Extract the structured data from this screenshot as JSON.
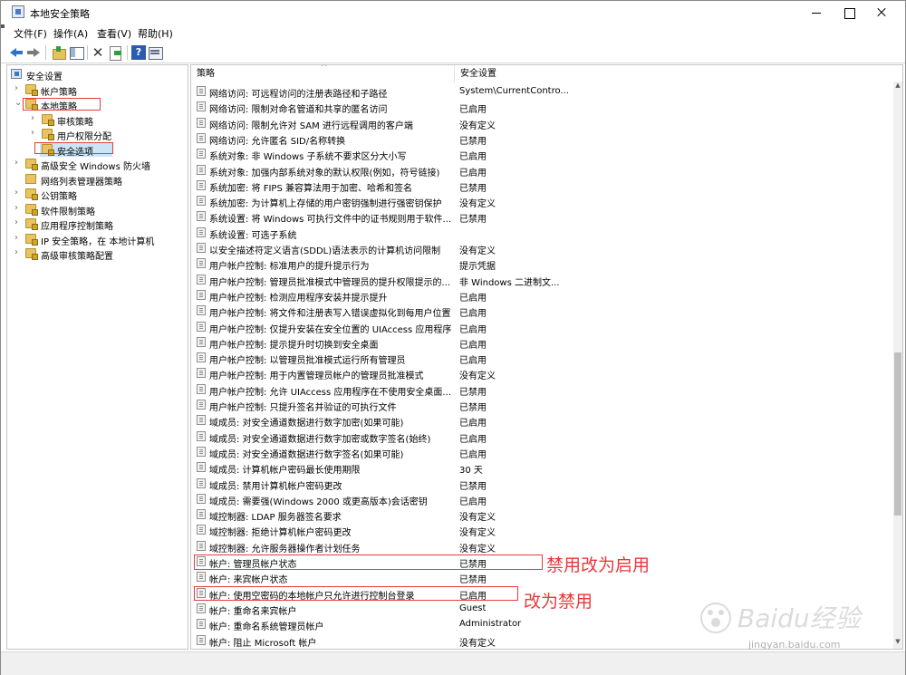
{
  "window": {
    "title": "本地安全策略",
    "minimize_icon": "minimize-icon",
    "maximize_icon": "maximize-icon",
    "close_icon": "close-icon"
  },
  "menubar": {
    "items": [
      "文件(F)",
      "操作(A)",
      "查看(V)",
      "帮助(H)"
    ]
  },
  "toolbar": {
    "icons": [
      "back-arrow-icon",
      "forward-arrow-icon",
      "up-folder-icon",
      "show-hide-tree-icon",
      "delete-icon",
      "export-list-icon",
      "help-icon",
      "properties-icon"
    ],
    "delete_glyph": "✕",
    "help_glyph": "?"
  },
  "tree": {
    "items": [
      {
        "label": "安全设置",
        "level": 0,
        "expanded": true
      },
      {
        "label": "帐户策略",
        "level": 1,
        "expanded": false
      },
      {
        "label": "本地策略",
        "level": 1,
        "expanded": true
      },
      {
        "label": "审核策略",
        "level": 2,
        "expanded": false
      },
      {
        "label": "用户权限分配",
        "level": 2,
        "expanded": false
      },
      {
        "label": "安全选项",
        "level": 2,
        "selected": true
      },
      {
        "label": "高级安全 Windows 防火墙",
        "level": 1,
        "expanded": false
      },
      {
        "label": "网络列表管理器策略",
        "level": 1
      },
      {
        "label": "公钥策略",
        "level": 1,
        "expanded": false
      },
      {
        "label": "软件限制策略",
        "level": 1,
        "expanded": false
      },
      {
        "label": "应用程序控制策略",
        "level": 1,
        "expanded": false
      },
      {
        "label": "IP 安全策略，在 本地计算机",
        "level": 1,
        "expanded": false
      },
      {
        "label": "高级审核策略配置",
        "level": 1,
        "expanded": false
      }
    ]
  },
  "list": {
    "columns": {
      "policy": "策略",
      "setting": "安全设置"
    },
    "rows": [
      {
        "policy": "网络访问: 可远程访问的注册表路径和子路径",
        "setting": "System\\CurrentContro..."
      },
      {
        "policy": "网络访问: 限制对命名管道和共享的匿名访问",
        "setting": "已启用"
      },
      {
        "policy": "网络访问: 限制允许对 SAM 进行远程调用的客户端",
        "setting": "没有定义"
      },
      {
        "policy": "网络访问: 允许匿名 SID/名称转换",
        "setting": "已禁用"
      },
      {
        "policy": "系统对象: 非 Windows 子系统不要求区分大小写",
        "setting": "已启用"
      },
      {
        "policy": "系统对象: 加强内部系统对象的默认权限(例如，符号链接)",
        "setting": "已启用"
      },
      {
        "policy": "系统加密: 将 FIPS 兼容算法用于加密、哈希和签名",
        "setting": "已禁用"
      },
      {
        "policy": "系统加密: 为计算机上存储的用户密钥强制进行强密钥保护",
        "setting": "没有定义"
      },
      {
        "policy": "系统设置: 将 Windows 可执行文件中的证书规则用于软件...",
        "setting": "已禁用"
      },
      {
        "policy": "系统设置: 可选子系统",
        "setting": ""
      },
      {
        "policy": "以安全描述符定义语言(SDDL)语法表示的计算机访问限制",
        "setting": "没有定义"
      },
      {
        "policy": "用户帐户控制: 标准用户的提升提示行为",
        "setting": "提示凭据"
      },
      {
        "policy": "用户帐户控制: 管理员批准模式中管理员的提升权限提示的...",
        "setting": "非 Windows 二进制文..."
      },
      {
        "policy": "用户帐户控制: 检测应用程序安装并提示提升",
        "setting": "已启用"
      },
      {
        "policy": "用户帐户控制: 将文件和注册表写入错误虚拟化到每用户位置",
        "setting": "已启用"
      },
      {
        "policy": "用户帐户控制: 仅提升安装在安全位置的 UIAccess 应用程序",
        "setting": "已启用"
      },
      {
        "policy": "用户帐户控制: 提示提升时切换到安全桌面",
        "setting": "已启用"
      },
      {
        "policy": "用户帐户控制: 以管理员批准模式运行所有管理员",
        "setting": "已启用"
      },
      {
        "policy": "用户帐户控制: 用于内置管理员帐户的管理员批准模式",
        "setting": "没有定义"
      },
      {
        "policy": "用户帐户控制: 允许 UIAccess 应用程序在不使用安全桌面...",
        "setting": "已禁用"
      },
      {
        "policy": "用户帐户控制: 只提升签名并验证的可执行文件",
        "setting": "已禁用"
      },
      {
        "policy": "域成员: 对安全通道数据进行数字加密(如果可能)",
        "setting": "已启用"
      },
      {
        "policy": "域成员: 对安全通道数据进行数字加密或数字签名(始终)",
        "setting": "已启用"
      },
      {
        "policy": "域成员: 对安全通道数据进行数字签名(如果可能)",
        "setting": "已启用"
      },
      {
        "policy": "域成员: 计算机帐户密码最长使用期限",
        "setting": "30 天"
      },
      {
        "policy": "域成员: 禁用计算机帐户密码更改",
        "setting": "已禁用"
      },
      {
        "policy": "域成员: 需要强(Windows 2000 或更高版本)会话密钥",
        "setting": "已启用"
      },
      {
        "policy": "域控制器: LDAP 服务器签名要求",
        "setting": "没有定义"
      },
      {
        "policy": "域控制器: 拒绝计算机帐户密码更改",
        "setting": "没有定义"
      },
      {
        "policy": "域控制器: 允许服务器操作者计划任务",
        "setting": "没有定义"
      },
      {
        "policy": "帐户: 管理员帐户状态",
        "setting": "已禁用"
      },
      {
        "policy": "帐户: 来宾帐户状态",
        "setting": "已禁用"
      },
      {
        "policy": "帐户: 使用空密码的本地帐户只允许进行控制台登录",
        "setting": "已启用"
      },
      {
        "policy": "帐户: 重命名来宾帐户",
        "setting": "Guest"
      },
      {
        "policy": "帐户: 重命名系统管理员帐户",
        "setting": "Administrator"
      },
      {
        "policy": "帐户: 阻止 Microsoft 帐户",
        "setting": "没有定义"
      }
    ]
  },
  "scrollbar": {
    "position_fraction": 0.68,
    "visible_fraction": 0.3
  },
  "annotations": {
    "note1": "禁用改为启用",
    "note2": "改为禁用",
    "color": "#e63939"
  },
  "watermark": {
    "logo_text": "Baidu经验",
    "url": "jingyan.baidu.com"
  }
}
